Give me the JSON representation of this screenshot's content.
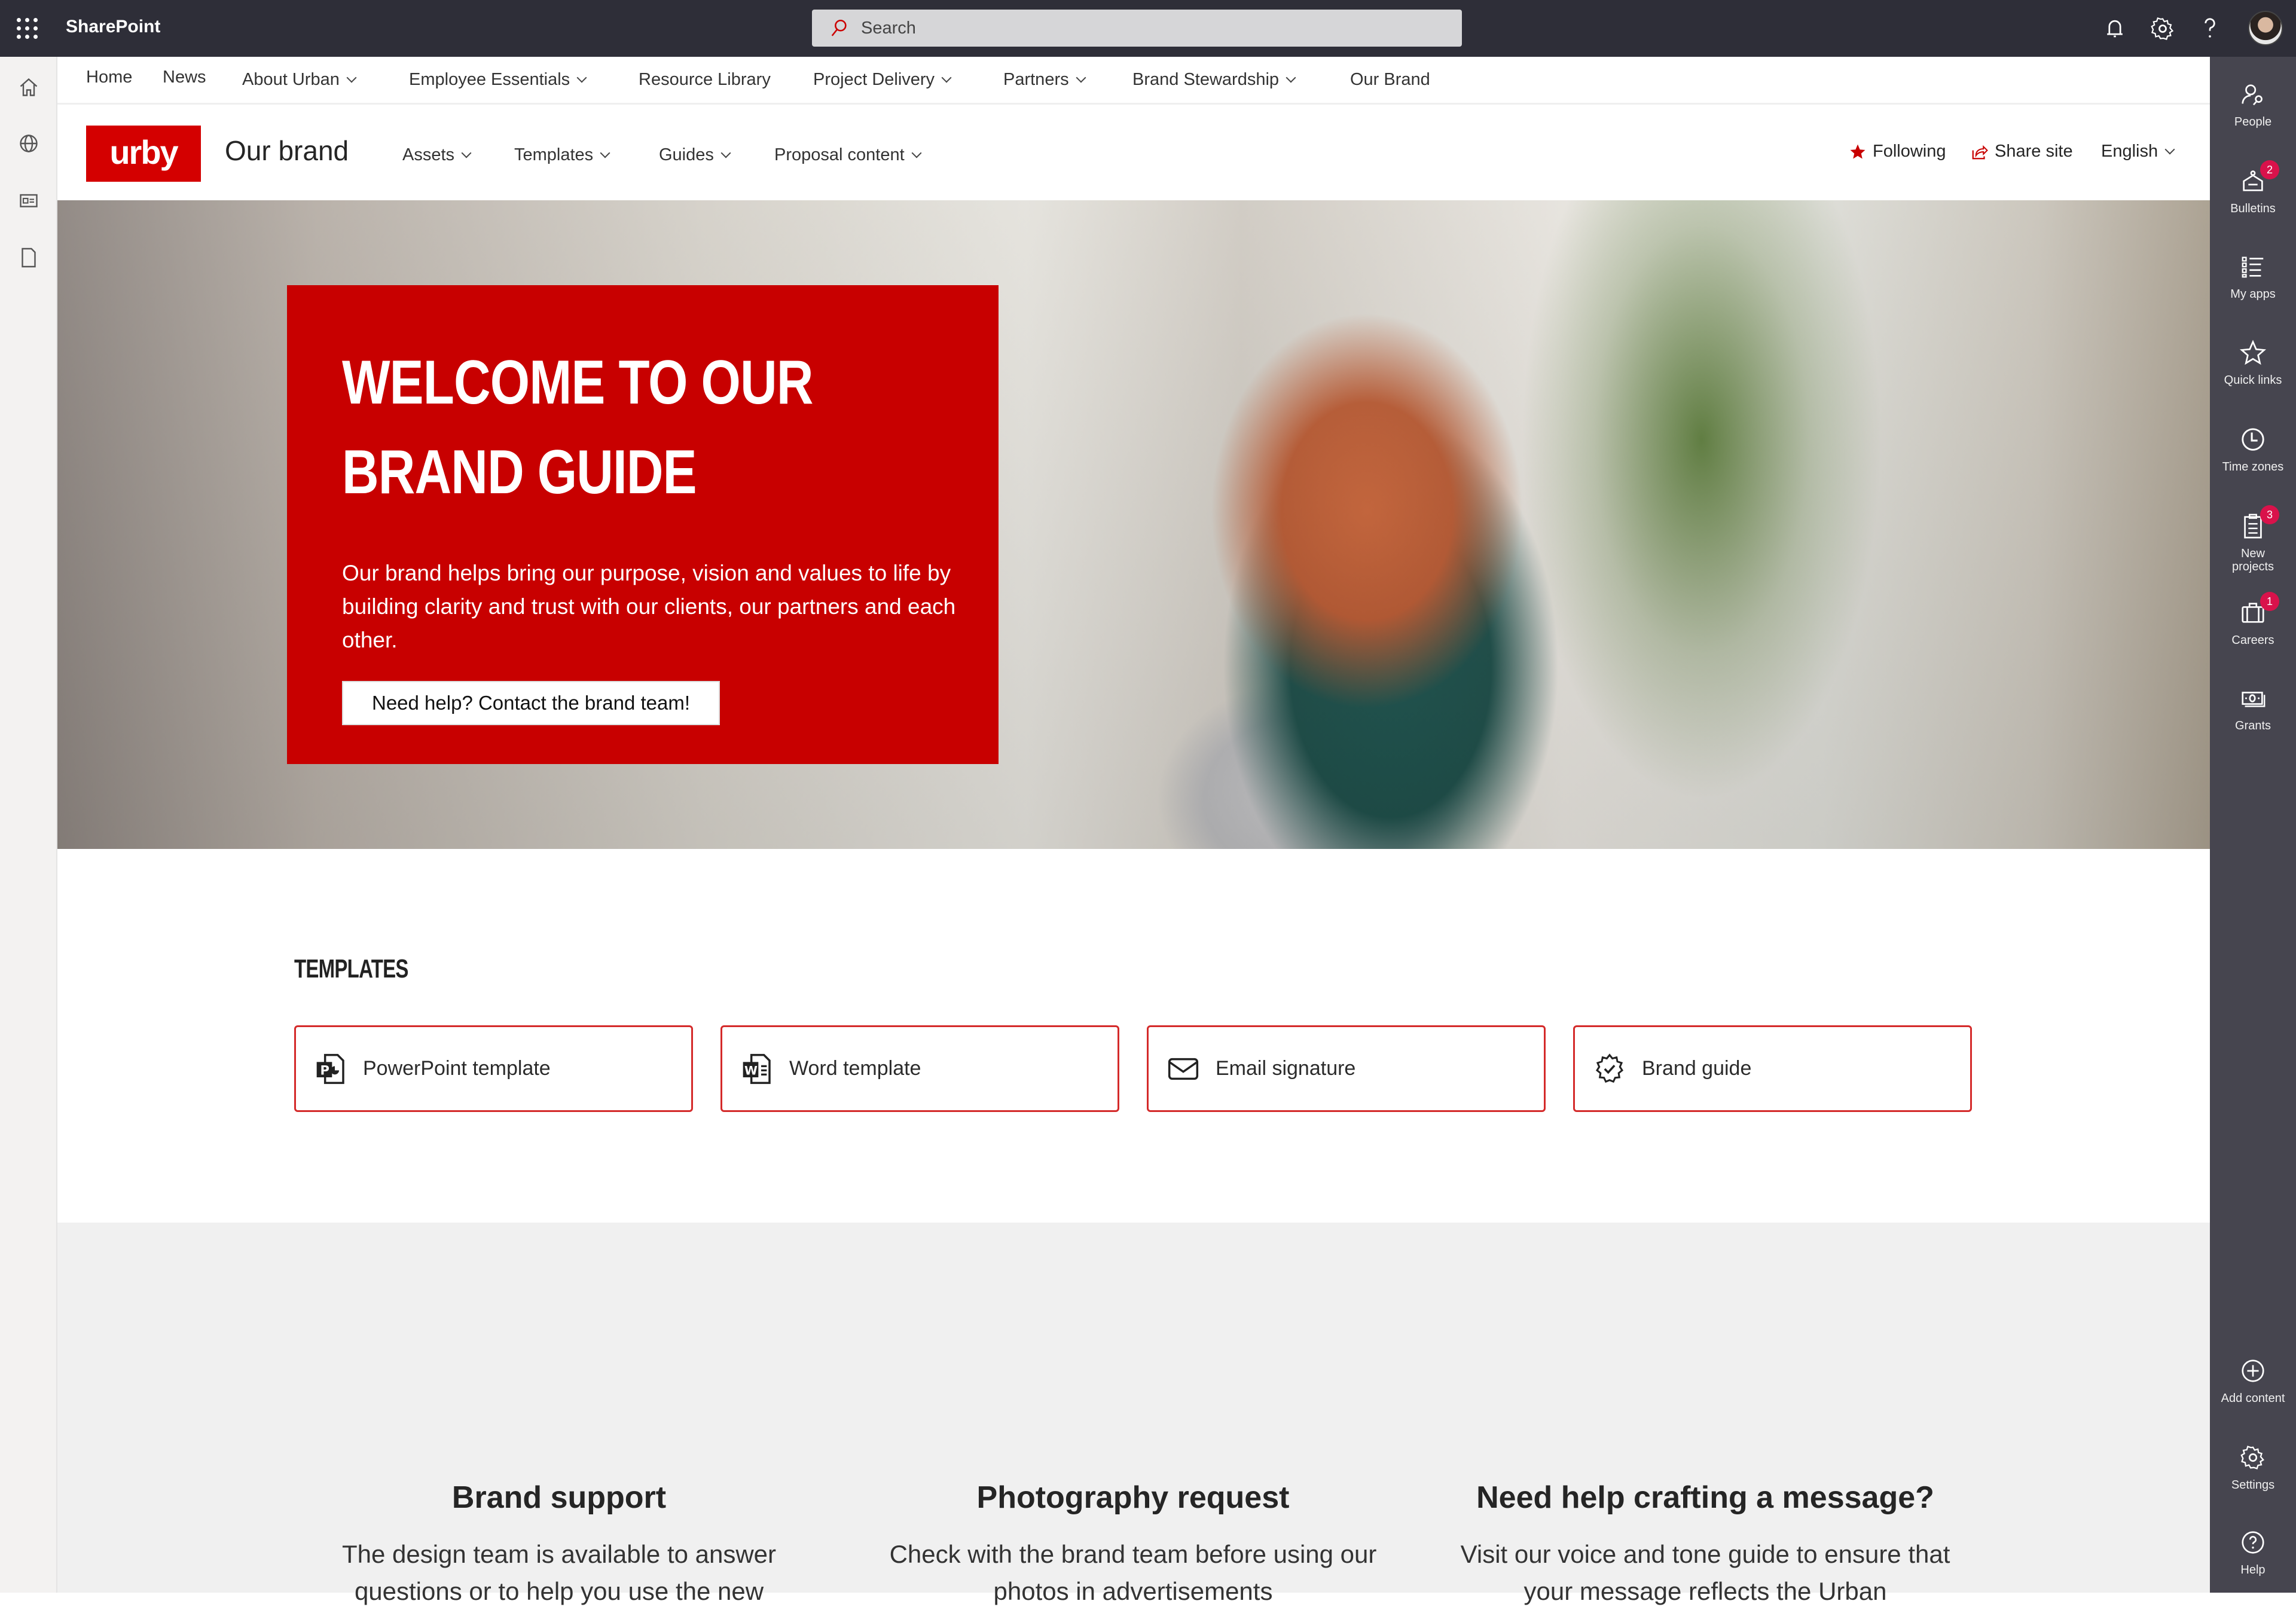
{
  "suite_bar": {
    "app_name": "SharePoint",
    "search_placeholder": "Search",
    "icons": [
      "waffle-icon",
      "bell-icon",
      "gear-icon",
      "help-icon",
      "avatar"
    ]
  },
  "left_rail": {
    "items": [
      {
        "icon": "home-icon"
      },
      {
        "icon": "globe-icon"
      },
      {
        "icon": "news-icon"
      },
      {
        "icon": "document-icon"
      }
    ]
  },
  "hub_nav": {
    "items": [
      {
        "label": "Home",
        "has_dropdown": false
      },
      {
        "label": "News",
        "has_dropdown": false
      },
      {
        "label": "About Urban",
        "has_dropdown": true
      },
      {
        "label": "Employee Essentials",
        "has_dropdown": true
      },
      {
        "label": "Resource Library",
        "has_dropdown": false
      },
      {
        "label": "Project Delivery",
        "has_dropdown": true
      },
      {
        "label": "Partners",
        "has_dropdown": true
      },
      {
        "label": "Brand Stewardship",
        "has_dropdown": true
      },
      {
        "label": "Our Brand",
        "has_dropdown": false
      }
    ]
  },
  "site_header": {
    "logo_text": "urby",
    "title": "Our brand",
    "nav": [
      {
        "label": "Assets"
      },
      {
        "label": "Templates"
      },
      {
        "label": "Guides"
      },
      {
        "label": "Proposal content"
      }
    ],
    "following_label": "Following",
    "share_label": "Share site",
    "language_label": "English"
  },
  "hero": {
    "title": "WELCOME TO OUR BRAND GUIDE",
    "body": "Our brand helps bring our purpose, vision and values to life by building clarity and trust with our clients, our partners and each other.",
    "button_label": "Need help? Contact the brand team!"
  },
  "templates": {
    "heading": "TEMPLATES",
    "cards": [
      {
        "label": "PowerPoint template",
        "icon": "powerpoint-icon"
      },
      {
        "label": "Word template",
        "icon": "word-icon"
      },
      {
        "label": "Email signature",
        "icon": "mail-icon"
      },
      {
        "label": "Brand guide",
        "icon": "badge-check-icon"
      }
    ]
  },
  "info_columns": [
    {
      "heading": "Brand support",
      "body": "The design team is available to answer questions or to help you use the new"
    },
    {
      "heading": "Photography request",
      "body": "Check with the brand team before using our photos in advertisements"
    },
    {
      "heading": "Need help crafting a message?",
      "body": "Visit our voice and tone guide to ensure that your message reflects the Urban"
    }
  ],
  "right_rail": {
    "items": [
      {
        "label": "People",
        "icon": "people-icon",
        "badge": null
      },
      {
        "label": "Bulletins",
        "icon": "bulletin-icon",
        "badge": "2"
      },
      {
        "label": "My apps",
        "icon": "apps-list-icon",
        "badge": null
      },
      {
        "label": "Quick links",
        "icon": "star-icon",
        "badge": null
      },
      {
        "label": "Time zones",
        "icon": "clock-icon",
        "badge": null
      },
      {
        "label": "New projects",
        "icon": "clipboard-icon",
        "badge": "3"
      },
      {
        "label": "Careers",
        "icon": "briefcase-icon",
        "badge": "1"
      },
      {
        "label": "Grants",
        "icon": "money-icon",
        "badge": null
      },
      {
        "label": "Add content",
        "icon": "plus-circle-icon",
        "badge": null
      },
      {
        "label": "Settings",
        "icon": "gear-icon",
        "badge": null
      },
      {
        "label": "Help",
        "icon": "help-circle-icon",
        "badge": null
      }
    ]
  },
  "colors": {
    "brand_red": "#c80000",
    "suite_bar": "#2e2e38",
    "right_rail": "#46454f",
    "badge": "#d9124b",
    "card_border": "#d42a2a"
  }
}
